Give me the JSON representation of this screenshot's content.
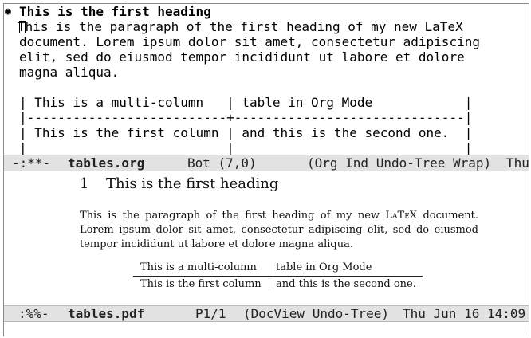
{
  "org_buffer": {
    "heading": "This is the first heading",
    "paragraph_lines": [
      "This is the paragraph of the first heading of my new LaTeX",
      "document. Lorem ipsum dolor sit amet, consectetur adipiscing",
      "elit, sed do eiusmod tempor incididunt ut labore et dolore",
      "magna aliqua."
    ],
    "table_lines": [
      "| This is a multi-column   | table in Org Mode            |",
      "|--------------------------+------------------------------|",
      "| This is the first column | and this is the second one.  |",
      "|                          |                              |"
    ]
  },
  "modeline_top": {
    "status": "-:**-",
    "buffer_name": "tables.org",
    "position": "Bot (7,0)",
    "modes": "(Org Ind Undo-Tree Wrap)",
    "datetime": "Thu"
  },
  "pdf_view": {
    "section_number": "1",
    "section_title": "This is the first heading",
    "paragraph_before": "This is the paragraph of the first heading of my new ",
    "latex_logo": "LaTeX",
    "paragraph_after": " document. Lorem ipsum dolor sit amet, consectetur adipiscing elit, sed do eiusmod tempor incididunt ut labore et dolore magna aliqua.",
    "table_header": [
      "This is a multi-column",
      "table in Org Mode"
    ],
    "table_row": [
      "This is the first column",
      "and this is the second one."
    ]
  },
  "modeline_bottom": {
    "status": ":%%-",
    "buffer_name": "tables.pdf",
    "position": "P1/1",
    "modes": "(DocView Undo-Tree)",
    "datetime": "Thu Jun 16 14:09"
  }
}
